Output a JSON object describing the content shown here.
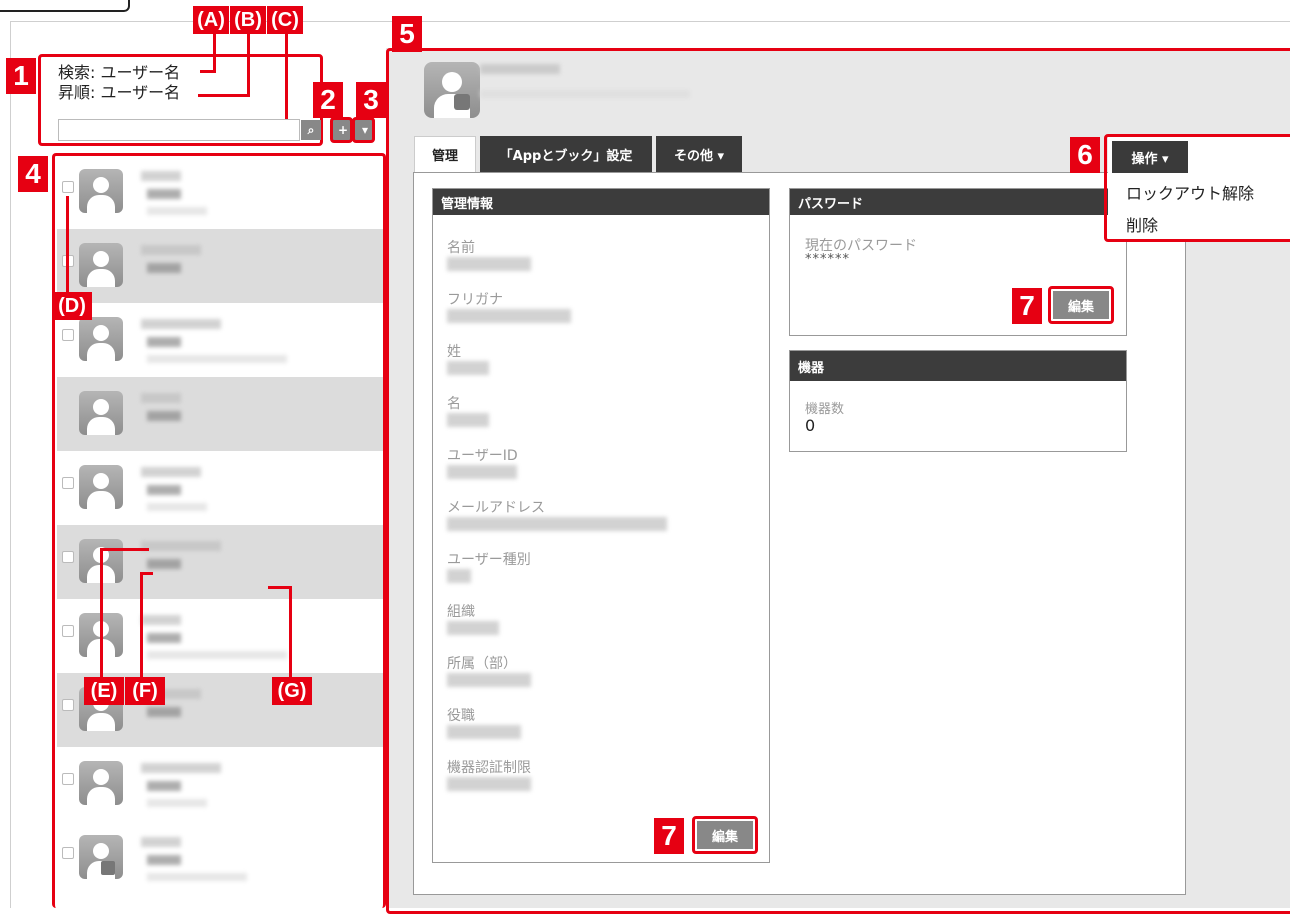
{
  "annotations": {
    "b1": "1",
    "b2": "2",
    "b3": "3",
    "b4": "4",
    "b5": "5",
    "b6": "6",
    "b7a": "7",
    "b7b": "7",
    "A": "(A)",
    "B": "(B)",
    "C": "(C)",
    "D": "(D)",
    "E": "(E)",
    "F": "(F)",
    "G": "(G)"
  },
  "search": {
    "search_text": "検索: ユーザー名",
    "sort_text": "昇順: ユーザー名",
    "input_value": "",
    "search_icon": "⌕",
    "add_icon": "+",
    "menu_icon": "▾"
  },
  "tabs": [
    {
      "label": "管理"
    },
    {
      "label": "「Appとブック」設定"
    },
    {
      "label": "その他 ▾"
    }
  ],
  "operation": {
    "label": "操作 ▾",
    "menu": [
      "ロックアウト解除",
      "削除"
    ]
  },
  "management": {
    "title": "管理情報",
    "fields": [
      "名前",
      "フリガナ",
      "姓",
      "名",
      "ユーザーID",
      "メールアドレス",
      "ユーザー種別",
      "組織",
      "所属（部）",
      "役職",
      "機器認証制限"
    ],
    "edit_label": "編集"
  },
  "password": {
    "title": "パスワード",
    "current_label": "現在のパスワード",
    "current_value": "******",
    "edit_label": "編集"
  },
  "devices": {
    "title": "機器",
    "count_label": "機器数",
    "count_value": "0"
  },
  "colors": {
    "annotation_red": "#e60012",
    "dark_header": "#3c3c3c",
    "panel_gray": "#e8e8e8"
  }
}
